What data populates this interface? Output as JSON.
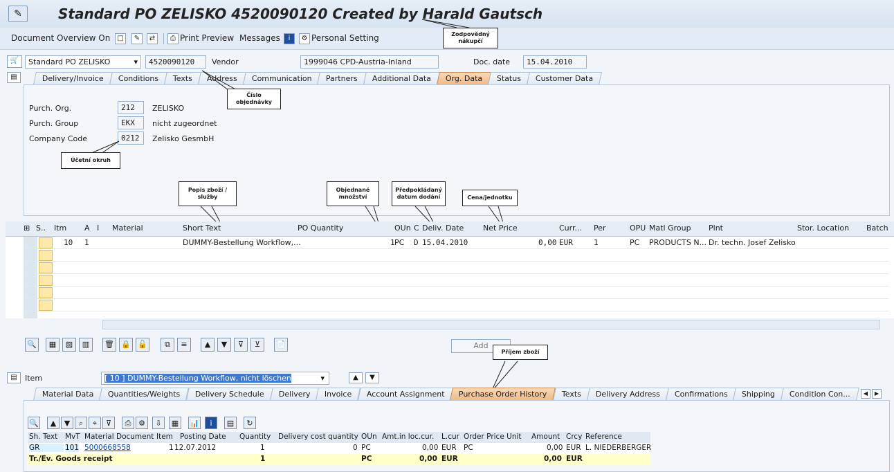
{
  "window": {
    "title": "Standard PO ZELISKO 4520090120 Created by Harald Gautsch"
  },
  "toolbar": {
    "doc_overview": "Document Overview On",
    "print_preview": "Print Preview",
    "messages": "Messages",
    "personal_setting": "Personal Setting"
  },
  "callouts": {
    "buyer": "Zodpovědný nákupčí",
    "po_number": "Číslo objednávky",
    "company_code": "Účetní okruh",
    "short_text": "Popis zboží / služby",
    "quantity": "Objednané množství",
    "delivery_date": "Předpokládaný datum dodání",
    "net_price": "Cena/jednotku",
    "goods_receipt": "Příjem zboží"
  },
  "header": {
    "doc_type": "Standard PO ZELISKO",
    "po_number": "4520090120",
    "vendor_label": "Vendor",
    "vendor_value": "1999046 CPD-Austria-Inland",
    "doc_date_label": "Doc. date",
    "doc_date_value": "15.04.2010",
    "tabs": [
      "Delivery/Invoice",
      "Conditions",
      "Texts",
      "Address",
      "Communication",
      "Partners",
      "Additional Data",
      "Org. Data",
      "Status",
      "Customer Data"
    ],
    "active_tab": "Org. Data"
  },
  "org": {
    "purch_org_label": "Purch. Org.",
    "purch_org_code": "212",
    "purch_org_name": "ZELISKO",
    "purch_group_label": "Purch. Group",
    "purch_group_code": "EKX",
    "purch_group_name": "nicht zugeordnet",
    "company_code_label": "Company Code",
    "company_code_code": "0212",
    "company_code_name": "Zelisko GesmbH"
  },
  "grid": {
    "columns": [
      "S..",
      "Itm",
      "A",
      "I",
      "Material",
      "Short Text",
      "PO Quantity",
      "OUn",
      "C",
      "Deliv. Date",
      "Net Price",
      "Curr...",
      "Per",
      "OPU",
      "Matl Group",
      "Plnt",
      "Stor. Location",
      "Batch"
    ],
    "row": {
      "itm": "10",
      "a": "1",
      "short_text": "DUMMY-Bestellung Workflow,...",
      "qty": "1",
      "oun": "PC",
      "c": "D",
      "deliv_date": "15.04.2010",
      "net_price": "0,00",
      "curr": "EUR",
      "per": "1",
      "opu": "PC",
      "matl_group": "PRODUCTS N...",
      "plnt": "Dr. techn. Josef Zelisko"
    },
    "add_button": "Add"
  },
  "item": {
    "label": "Item",
    "selected": "[ 10 ] DUMMY-Bestellung Workflow, nicht löschen",
    "tabs": [
      "Material Data",
      "Quantities/Weights",
      "Delivery Schedule",
      "Delivery",
      "Invoice",
      "Account Assignment",
      "Purchase Order History",
      "Texts",
      "Delivery Address",
      "Confirmations",
      "Shipping",
      "Condition Con..."
    ],
    "active_tab": "Purchase Order History"
  },
  "history": {
    "columns": [
      "Sh. Text",
      "MvT",
      "Material Document",
      "Item",
      "Posting Date",
      "Quantity",
      "Delivery cost quantity",
      "OUn",
      "Amt.in loc.cur.",
      "L.cur",
      "Order Price Unit",
      "Amount",
      "Crcy",
      "Reference"
    ],
    "row": {
      "sh_text": "GR",
      "mvt": "101",
      "mat_doc": "5000668558",
      "item": "1",
      "posting_date": "12.07.2012",
      "quantity": "1",
      "dcq": "0",
      "oun": "PC",
      "amt_loc": "0,00",
      "lcur": "EUR",
      "opu": "PC",
      "amount": "0,00",
      "crcy": "EUR",
      "reference": "L. NIEDERBERGER"
    },
    "total": {
      "label": "Tr./Ev. Goods receipt",
      "quantity": "1",
      "oun": "PC",
      "amt_loc": "0,00",
      "lcur": "EUR",
      "amount": "0,00",
      "crcy": "EUR"
    }
  },
  "colors": {
    "active_tab": "#f0b988",
    "highlight_row": "#ffffc8",
    "gr_row": "#d9f1ff"
  }
}
